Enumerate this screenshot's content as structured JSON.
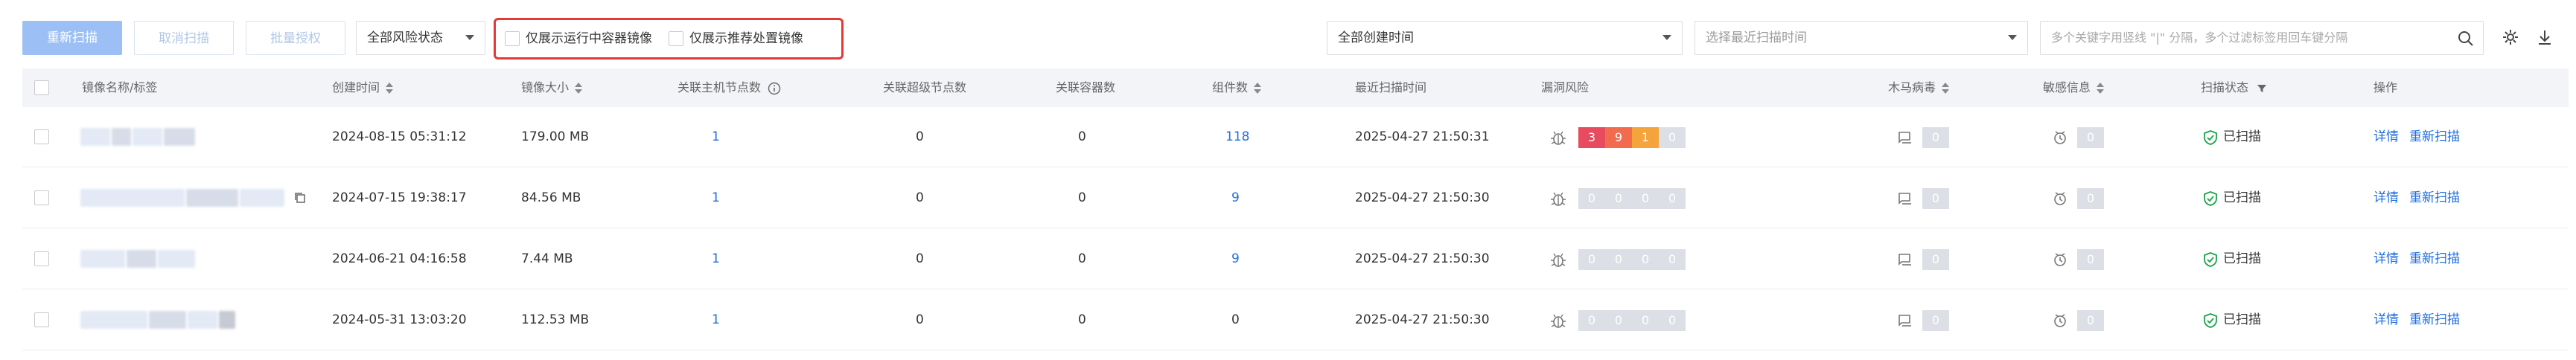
{
  "toolbar": {
    "rescan": "重新扫描",
    "cancel_scan": "取消扫描",
    "batch_auth": "批量授权",
    "risk_filter": "全部风险状态",
    "only_running": "仅展示运行中容器镜像",
    "only_recommended": "仅展示推荐处置镜像",
    "created_filter": "全部创建时间",
    "last_scan_filter_placeholder": "选择最近扫描时间",
    "search_placeholder": "多个关键字用竖线 \"|\" 分隔，多个过滤标签用回车键分隔"
  },
  "columns": {
    "image_name": "镜像名称/标签",
    "created_at": "创建时间",
    "image_size": "镜像大小",
    "host_nodes": "关联主机节点数",
    "super_nodes": "关联超级节点数",
    "containers": "关联容器数",
    "components": "组件数",
    "last_scan": "最近扫描时间",
    "vuln_risk": "漏洞风险",
    "trojan": "木马病毒",
    "sensitive": "敏感信息",
    "scan_status": "扫描状态",
    "actions": "操作"
  },
  "rows": [
    {
      "created_at": "2024-08-15 05:31:12",
      "size": "179.00 MB",
      "host_nodes": "1",
      "super_nodes": "0",
      "containers": "0",
      "components": "118",
      "last_scan": "2025-04-27 21:50:31",
      "vuln": [
        "3",
        "9",
        "1",
        "0"
      ],
      "trojan": "0",
      "sensitive": "0",
      "status": "已扫描",
      "detail": "详情",
      "rescan": "重新扫描"
    },
    {
      "created_at": "2024-07-15 19:38:17",
      "size": "84.56 MB",
      "host_nodes": "1",
      "super_nodes": "0",
      "containers": "0",
      "components": "9",
      "last_scan": "2025-04-27 21:50:30",
      "vuln": [
        "0",
        "0",
        "0",
        "0"
      ],
      "trojan": "0",
      "sensitive": "0",
      "status": "已扫描",
      "detail": "详情",
      "rescan": "重新扫描"
    },
    {
      "created_at": "2024-06-21 04:16:58",
      "size": "7.44 MB",
      "host_nodes": "1",
      "super_nodes": "0",
      "containers": "0",
      "components": "9",
      "last_scan": "2025-04-27 21:50:30",
      "vuln": [
        "0",
        "0",
        "0",
        "0"
      ],
      "trojan": "0",
      "sensitive": "0",
      "status": "已扫描",
      "detail": "详情",
      "rescan": "重新扫描"
    },
    {
      "created_at": "2024-05-31 13:03:20",
      "size": "112.53 MB",
      "host_nodes": "1",
      "super_nodes": "0",
      "containers": "0",
      "components": "0",
      "last_scan": "2025-04-27 21:50:30",
      "vuln": [
        "0",
        "0",
        "0",
        "0"
      ],
      "trojan": "0",
      "sensitive": "0",
      "status": "已扫描",
      "detail": "详情",
      "rescan": "重新扫描"
    }
  ],
  "colors": {
    "primary": "#1f6fe0",
    "critical": "#e84a5f",
    "high": "#f26b4f",
    "medium": "#f5a33b",
    "low": "#dcdfe5",
    "ok_green": "#1aa34a",
    "highlight_red": "#e53935"
  },
  "icons": [
    "search-icon",
    "gear-icon",
    "download-icon",
    "info-icon",
    "filter-icon",
    "copy-icon",
    "bug-icon",
    "trojan-icon",
    "sensitive-icon",
    "shield-check-icon"
  ]
}
